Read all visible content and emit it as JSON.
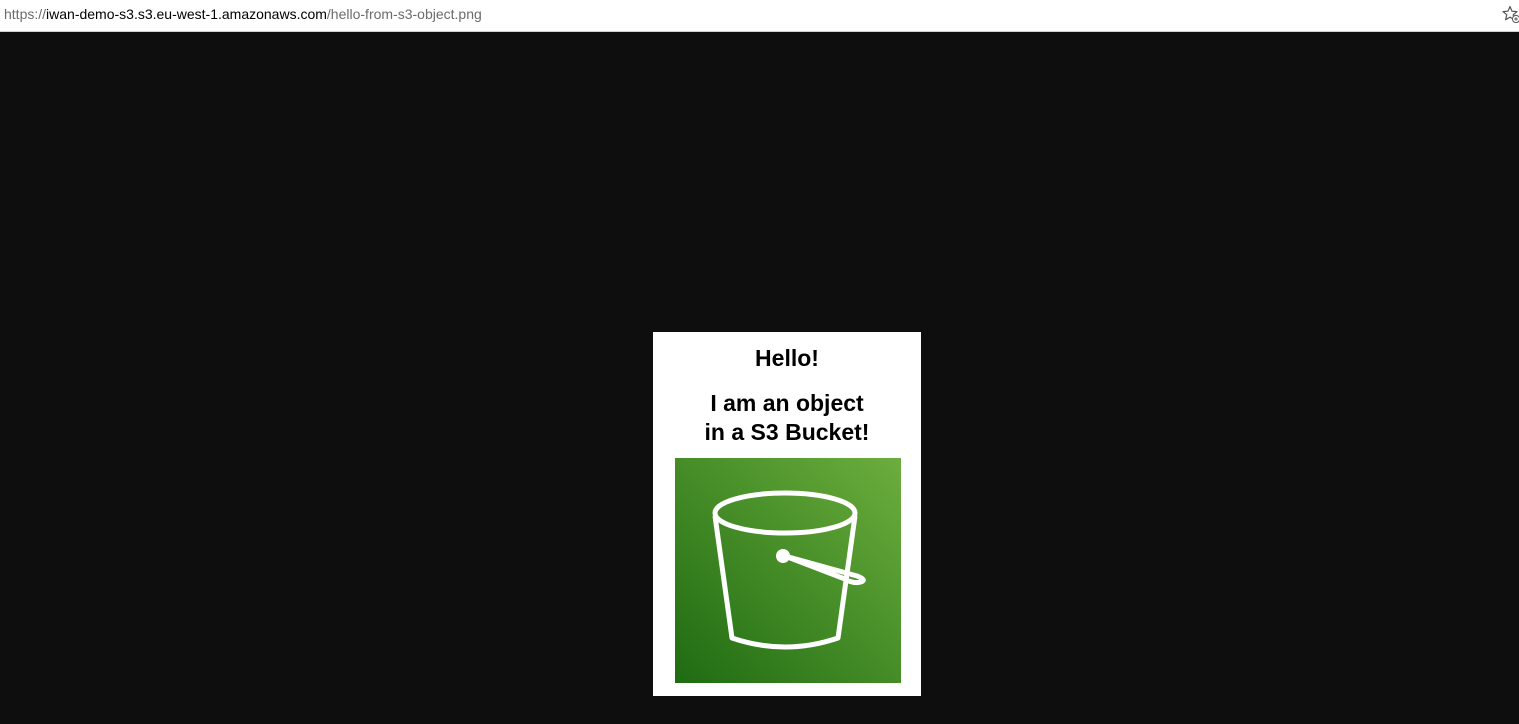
{
  "browser": {
    "url_scheme": "https://",
    "url_host": "iwan-demo-s3.s3.eu-west-1.amazonaws.com",
    "url_path": "/hello-from-s3-object.png",
    "bookmark_icon": "star-icon"
  },
  "image": {
    "hello": "Hello!",
    "line1": "I am an object",
    "line2": "in a S3 Bucket!",
    "icon": "s3-bucket-icon",
    "icon_colors": {
      "gradient_dark": "#1f6b12",
      "gradient_light": "#6cae3d",
      "stroke": "#ffffff"
    }
  },
  "colors": {
    "viewer_background": "#0e0e0e",
    "urlbar_background": "#ffffff"
  }
}
